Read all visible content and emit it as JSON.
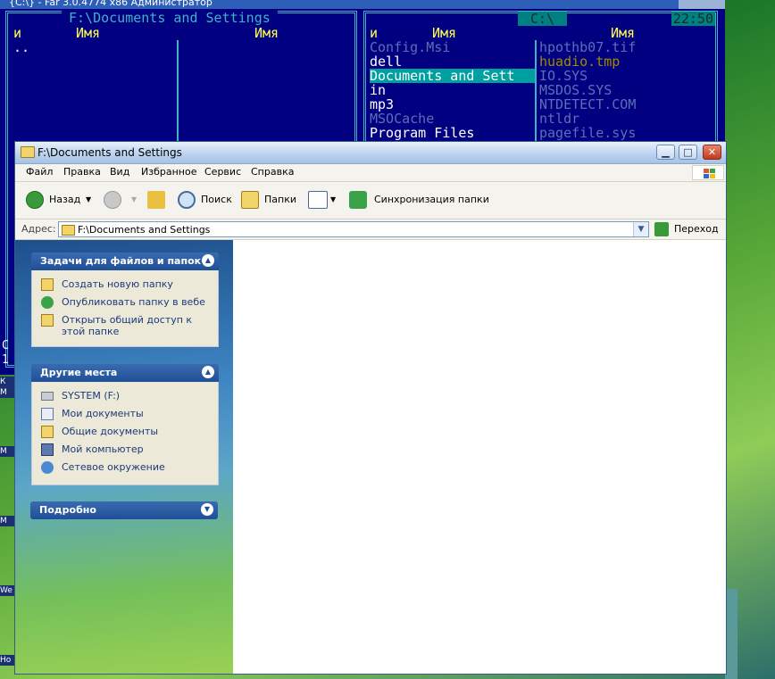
{
  "far": {
    "title": "{C:\\} - Far 3.0.4774 x86 Администратор",
    "left_panel": {
      "path": "F:\\Documents and Settings",
      "col_n": "и",
      "col_name1": "Имя",
      "col_name2": "Имя",
      "items": [
        ".."
      ]
    },
    "right_panel": {
      "path": "C:\\",
      "clock": "22:50",
      "col_n": "и",
      "col_name1": "Имя",
      "col_name2": "Имя",
      "col1": [
        "Config.Msi",
        "dell",
        "Documents and Sett",
        "in",
        "mp3",
        "MSOCache",
        "Program Files"
      ],
      "col2": [
        "hpothb07.tif",
        "huadio.tmp",
        "IO.SYS",
        "MSDOS.SYS",
        "NTDETECT.COM",
        "ntldr",
        "pagefile.sys"
      ]
    },
    "cmd_lines": [
      "C",
      "1"
    ]
  },
  "desktop_labels": [
    "К\nМ",
    "М",
    "М",
    "We",
    "Ho"
  ],
  "explorer": {
    "title": "F:\\Documents and Settings",
    "menu": [
      "Файл",
      "Правка",
      "Вид",
      "Избранное",
      "Сервис",
      "Справка"
    ],
    "toolbar": {
      "back": "Назад",
      "search": "Поиск",
      "folders": "Папки",
      "sync": "Синхронизация папки"
    },
    "address": {
      "label": "Адрес:",
      "value": "F:\\Documents and Settings",
      "go": "Переход"
    },
    "tasks": {
      "header": "Задачи для файлов и папок",
      "items": [
        "Создать новую папку",
        "Опубликовать папку в вебе",
        "Открыть общий доступ к этой папке"
      ]
    },
    "places": {
      "header": "Другие места",
      "items": [
        "SYSTEM (F:)",
        "Мои документы",
        "Общие документы",
        "Мой компьютер",
        "Сетевое окружение"
      ]
    },
    "details": {
      "header": "Подробно"
    }
  }
}
